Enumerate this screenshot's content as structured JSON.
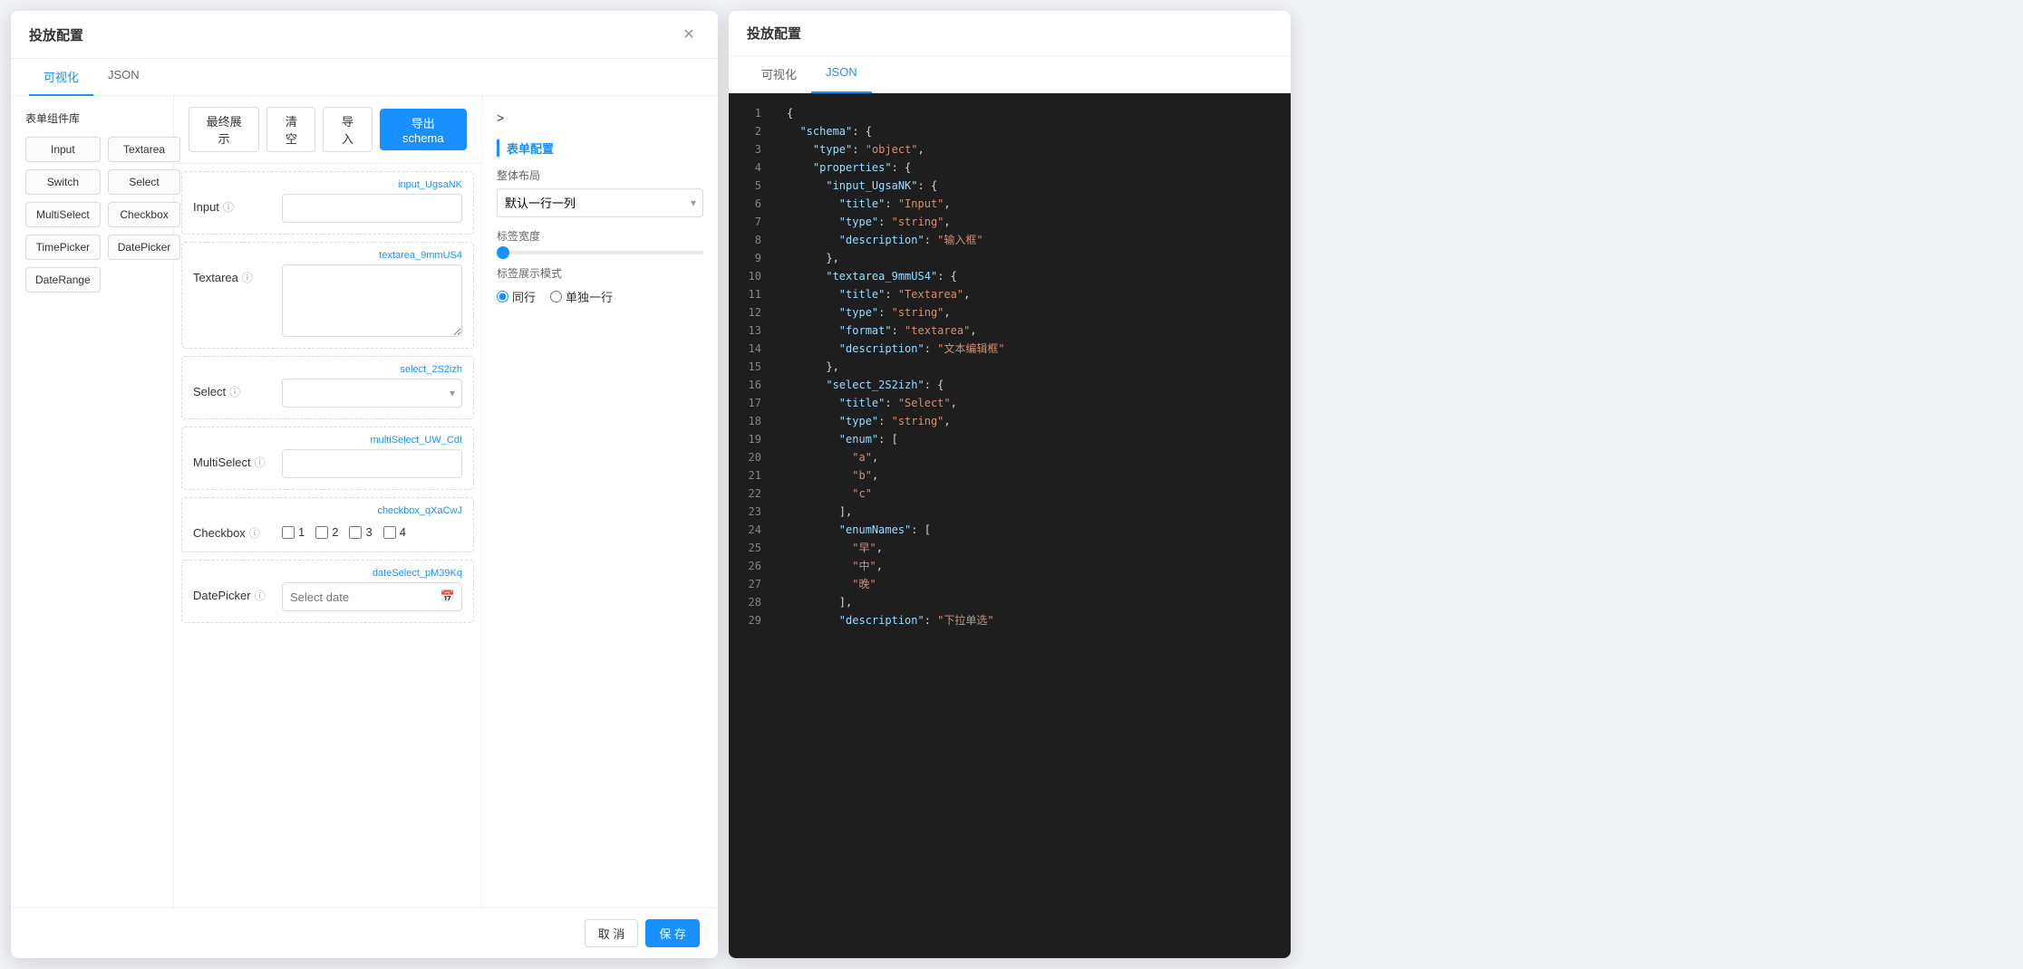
{
  "leftModal": {
    "title": "投放配置",
    "tabs": [
      {
        "label": "可视化",
        "active": true
      },
      {
        "label": "JSON",
        "active": false
      }
    ],
    "toolbar": {
      "finalDisplay": "最终展示",
      "clear": "清空",
      "import": "导入",
      "exportSchema": "导出schema"
    },
    "componentLibrary": {
      "title": "表单组件库",
      "components": [
        {
          "label": "Input"
        },
        {
          "label": "Textarea"
        },
        {
          "label": "Switch"
        },
        {
          "label": "Select"
        },
        {
          "label": "MultiSelect"
        },
        {
          "label": "Checkbox"
        },
        {
          "label": "TimePicker"
        },
        {
          "label": "DatePicker"
        },
        {
          "label": "DateRange"
        }
      ]
    },
    "formFields": [
      {
        "id": "input_UgsaNK",
        "type": "input",
        "label": "Input",
        "placeholder": ""
      },
      {
        "id": "textarea_9mmUS4",
        "type": "textarea",
        "label": "Textarea",
        "placeholder": ""
      },
      {
        "id": "select_2S2izh",
        "type": "select",
        "label": "Select",
        "placeholder": ""
      },
      {
        "id": "multiSelect_UW_CdI",
        "type": "multiselect",
        "label": "MultiSelect",
        "placeholder": ""
      },
      {
        "id": "checkbox_qXaCwJ",
        "type": "checkbox",
        "label": "Checkbox",
        "options": [
          "1",
          "2",
          "3",
          "4"
        ]
      },
      {
        "id": "dateSelect_pM39Kq",
        "type": "datepicker",
        "label": "DatePicker",
        "placeholder": "Select date"
      }
    ],
    "propertiesPanel": {
      "expandIcon": ">",
      "sectionTitle": "表单配置",
      "layoutLabel": "整体布局",
      "layoutDefault": "默认一行一列",
      "labelWidthLabel": "标签宽度",
      "labelDisplayLabel": "标签展示模式",
      "radioOptions": [
        {
          "label": "同行",
          "checked": true
        },
        {
          "label": "单独一行",
          "checked": false
        }
      ]
    },
    "footer": {
      "cancel": "取 消",
      "save": "保 存"
    }
  },
  "rightModal": {
    "title": "投放配置",
    "tabs": [
      {
        "label": "可视化",
        "active": false
      },
      {
        "label": "JSON",
        "active": true
      }
    ],
    "jsonLines": [
      {
        "num": 1,
        "content": "{",
        "type": "bracket"
      },
      {
        "num": 2,
        "content": "  \"schema\": {",
        "parts": [
          {
            "t": "key",
            "v": "\"schema\""
          },
          {
            "t": "colon",
            "v": ": {"
          }
        ]
      },
      {
        "num": 3,
        "content": "    \"type\": \"object\","
      },
      {
        "num": 4,
        "content": "    \"properties\": {"
      },
      {
        "num": 5,
        "content": "      \"input_UgsaNK\": {"
      },
      {
        "num": 6,
        "content": "        \"title\": \"Input\","
      },
      {
        "num": 7,
        "content": "        \"type\": \"string\","
      },
      {
        "num": 8,
        "content": "        \"description\": \"输入框\""
      },
      {
        "num": 9,
        "content": "      },"
      },
      {
        "num": 10,
        "content": "      \"textarea_9mmUS4\": {"
      },
      {
        "num": 11,
        "content": "        \"title\": \"Textarea\","
      },
      {
        "num": 12,
        "content": "        \"type\": \"string\","
      },
      {
        "num": 13,
        "content": "        \"format\": \"textarea\","
      },
      {
        "num": 14,
        "content": "        \"description\": \"文本编辑框\""
      },
      {
        "num": 15,
        "content": "      },"
      },
      {
        "num": 16,
        "content": "      \"select_2S2izh\": {"
      },
      {
        "num": 17,
        "content": "        \"title\": \"Select\","
      },
      {
        "num": 18,
        "content": "        \"type\": \"string\","
      },
      {
        "num": 19,
        "content": "        \"enum\": ["
      },
      {
        "num": 20,
        "content": "          \"a\","
      },
      {
        "num": 21,
        "content": "          \"b\","
      },
      {
        "num": 22,
        "content": "          \"c\""
      },
      {
        "num": 23,
        "content": "        ],"
      },
      {
        "num": 24,
        "content": "        \"enumNames\": ["
      },
      {
        "num": 25,
        "content": "          \"早\","
      },
      {
        "num": 26,
        "content": "          \"中\","
      },
      {
        "num": 27,
        "content": "          \"晚\""
      },
      {
        "num": 28,
        "content": "        ],"
      },
      {
        "num": 29,
        "content": "        \"description\": \"下拉单选\""
      }
    ]
  }
}
